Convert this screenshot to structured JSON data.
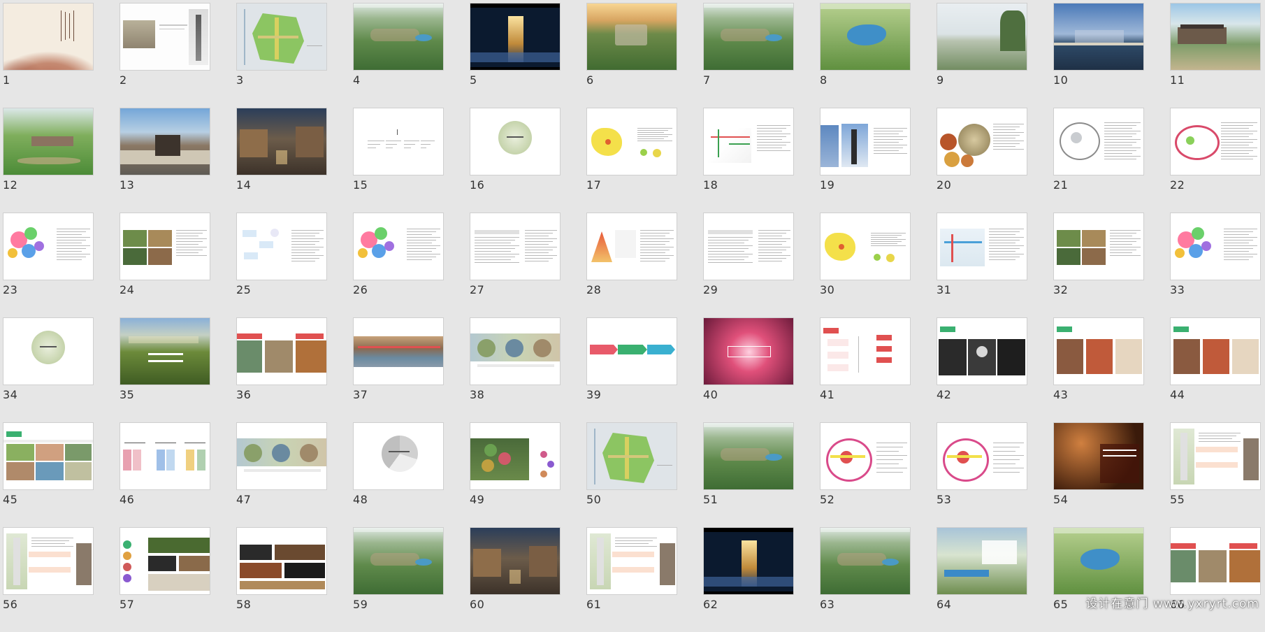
{
  "slides": [
    {
      "n": "1",
      "s": "cover"
    },
    {
      "n": "2",
      "s": "photos2"
    },
    {
      "n": "3",
      "s": "map"
    },
    {
      "n": "4",
      "s": "aerial"
    },
    {
      "n": "5",
      "s": "night"
    },
    {
      "n": "6",
      "s": "sunset"
    },
    {
      "n": "7",
      "s": "aerial"
    },
    {
      "n": "8",
      "s": "lake"
    },
    {
      "n": "9",
      "s": "sky"
    },
    {
      "n": "10",
      "s": "bridge"
    },
    {
      "n": "11",
      "s": "courtyard"
    },
    {
      "n": "12",
      "s": "garden"
    },
    {
      "n": "13",
      "s": "building"
    },
    {
      "n": "14",
      "s": "street"
    },
    {
      "n": "15",
      "s": "toc"
    },
    {
      "n": "16",
      "s": "circle"
    },
    {
      "n": "17",
      "s": "yellowmap"
    },
    {
      "n": "18",
      "s": "road"
    },
    {
      "n": "19",
      "s": "pagoda"
    },
    {
      "n": "20",
      "s": "food"
    },
    {
      "n": "21",
      "s": "sketch"
    },
    {
      "n": "22",
      "s": "loop"
    },
    {
      "n": "23",
      "s": "bubbles"
    },
    {
      "n": "24",
      "s": "photogrid"
    },
    {
      "n": "25",
      "s": "flow"
    },
    {
      "n": "26",
      "s": "bubbles"
    },
    {
      "n": "27",
      "s": "table"
    },
    {
      "n": "28",
      "s": "pyramid"
    },
    {
      "n": "29",
      "s": "table"
    },
    {
      "n": "30",
      "s": "yellowmap"
    },
    {
      "n": "31",
      "s": "blueplan"
    },
    {
      "n": "32",
      "s": "photogrid"
    },
    {
      "n": "33",
      "s": "bubbles"
    },
    {
      "n": "34",
      "s": "circle"
    },
    {
      "n": "35",
      "s": "field"
    },
    {
      "n": "36",
      "s": "collage"
    },
    {
      "n": "37",
      "s": "band"
    },
    {
      "n": "38",
      "s": "hex"
    },
    {
      "n": "39",
      "s": "arrows"
    },
    {
      "n": "40",
      "s": "pink"
    },
    {
      "n": "41",
      "s": "diagram"
    },
    {
      "n": "42",
      "s": "dark3"
    },
    {
      "n": "43",
      "s": "photos3"
    },
    {
      "n": "44",
      "s": "photos3"
    },
    {
      "n": "45",
      "s": "kids"
    },
    {
      "n": "46",
      "s": "columns"
    },
    {
      "n": "47",
      "s": "hex"
    },
    {
      "n": "48",
      "s": "pie"
    },
    {
      "n": "49",
      "s": "greenmap"
    },
    {
      "n": "50",
      "s": "map"
    },
    {
      "n": "51",
      "s": "aerial"
    },
    {
      "n": "52",
      "s": "zones"
    },
    {
      "n": "53",
      "s": "zones"
    },
    {
      "n": "54",
      "s": "lights"
    },
    {
      "n": "55",
      "s": "plan"
    },
    {
      "n": "56",
      "s": "plan"
    },
    {
      "n": "57",
      "s": "steps"
    },
    {
      "n": "58",
      "s": "labels"
    },
    {
      "n": "59",
      "s": "aerial"
    },
    {
      "n": "60",
      "s": "street"
    },
    {
      "n": "61",
      "s": "plan"
    },
    {
      "n": "62",
      "s": "night"
    },
    {
      "n": "63",
      "s": "aerial"
    },
    {
      "n": "64",
      "s": "board"
    },
    {
      "n": "65",
      "s": "lake"
    },
    {
      "n": "66",
      "s": "collage"
    }
  ],
  "watermark": "设计在意门 www.yxryrt.com"
}
